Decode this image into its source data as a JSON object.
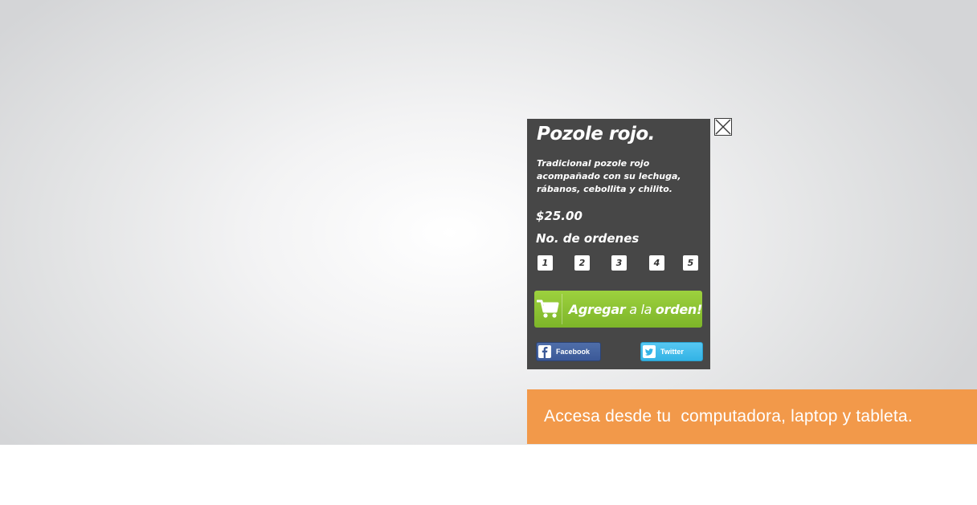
{
  "product": {
    "title": "Pozole rojo.",
    "description": "Tradicional pozole rojo acompañado con su lechuga, rábanos, cebollita y chilito.",
    "price": "$25.00",
    "orders_label": "No. de ordenes",
    "quantities": [
      "1",
      "2",
      "3",
      "4",
      "5"
    ]
  },
  "add_button": {
    "part1": "Agregar",
    "part2": " a la ",
    "part3": "orden!"
  },
  "share": {
    "facebook_label": "Facebook",
    "twitter_label": "Twitter"
  },
  "banner": {
    "text": "Accesa desde tu  computadora, laptop y tableta."
  },
  "colors": {
    "popup_bg": "#474747",
    "add_button": "#8cc63f",
    "banner": "#f2994a",
    "facebook": "#3b5998",
    "twitter": "#33b3e5"
  },
  "icons": [
    "close-icon",
    "cart-icon",
    "facebook-icon",
    "twitter-icon"
  ]
}
